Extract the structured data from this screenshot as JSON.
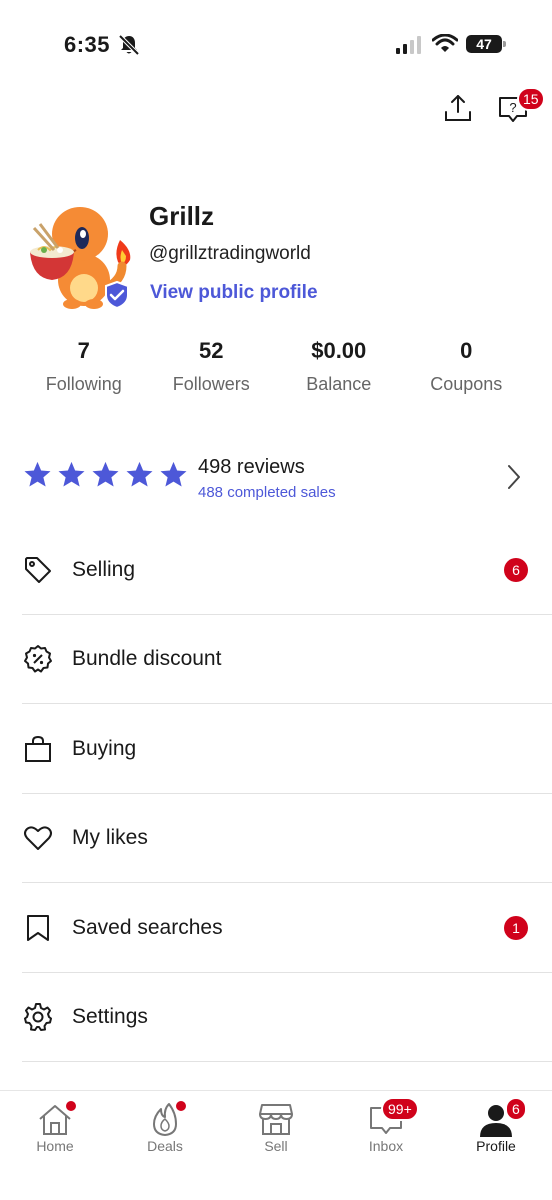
{
  "status_bar": {
    "time": "6:35",
    "battery": "47",
    "icons": [
      "bell-off-icon",
      "signal-icon",
      "wifi-icon",
      "battery-icon"
    ]
  },
  "top_actions": {
    "share_icon": "share-icon",
    "help_icon": "help-chat-icon",
    "help_badge": "15"
  },
  "profile": {
    "name": "Grillz",
    "handle": "@grillztradingworld",
    "view_link": "View public profile",
    "avatar": "charmander-ramen-avatar",
    "verified": true
  },
  "stats": [
    {
      "value": "7",
      "label": "Following"
    },
    {
      "value": "52",
      "label": "Followers"
    },
    {
      "value": "$0.00",
      "label": "Balance"
    },
    {
      "value": "0",
      "label": "Coupons"
    }
  ],
  "reviews": {
    "rating": 5,
    "count_text": "498 reviews",
    "sales_text": "488 completed sales"
  },
  "menu": {
    "items": [
      {
        "label": "Selling",
        "icon": "tag-icon",
        "badge": "6"
      },
      {
        "label": "Bundle discount",
        "icon": "discount-badge-icon",
        "badge": ""
      },
      {
        "label": "Buying",
        "icon": "shopping-bag-icon",
        "badge": ""
      },
      {
        "label": "My likes",
        "icon": "heart-icon",
        "badge": ""
      },
      {
        "label": "Saved searches",
        "icon": "bookmark-icon",
        "badge": "1"
      },
      {
        "label": "Settings",
        "icon": "gear-icon",
        "badge": ""
      }
    ]
  },
  "bottom_nav": {
    "items": [
      {
        "label": "Home",
        "icon": "home-icon",
        "badge": "dot"
      },
      {
        "label": "Deals",
        "icon": "flame-icon",
        "badge": "dot"
      },
      {
        "label": "Sell",
        "icon": "storefront-icon",
        "badge": ""
      },
      {
        "label": "Inbox",
        "icon": "chat-icon",
        "badge": "99+"
      },
      {
        "label": "Profile",
        "icon": "person-icon",
        "badge": "6",
        "active": true
      }
    ]
  },
  "colors": {
    "accent": "#4d58d8",
    "badge": "#d0021b",
    "text": "#1a1a1a",
    "muted": "#666666"
  }
}
